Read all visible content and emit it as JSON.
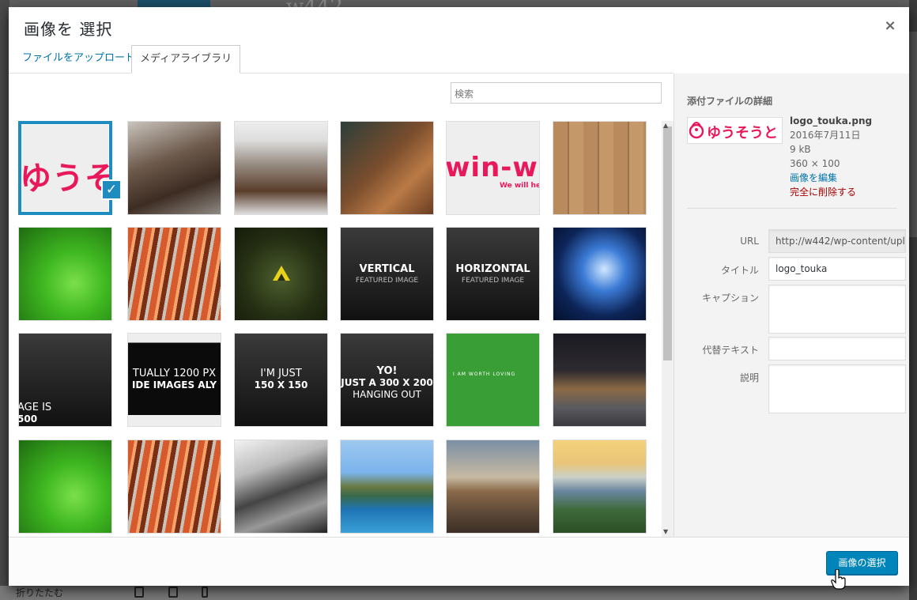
{
  "background": {
    "bottom_label": "折りたたむ",
    "ghost_title": "w442"
  },
  "modal": {
    "title": "画像を 選択",
    "close_label": "×",
    "tabs": [
      {
        "label": "ファイルをアップロード",
        "active": false
      },
      {
        "label": "メディアライブラリ",
        "active": true
      }
    ],
    "search_placeholder": "検索"
  },
  "tiles": [
    {
      "kind": "text-pink",
      "text": "ゆうそう",
      "selected": true
    },
    {
      "kind": "photo",
      "desc": "woman-reading"
    },
    {
      "kind": "photo",
      "desc": "book-coffee"
    },
    {
      "kind": "photo",
      "desc": "notebook-desk"
    },
    {
      "kind": "text-pink",
      "text": "win-wi",
      "sub": "We will hel"
    },
    {
      "kind": "photo",
      "desc": "wood-laptop"
    },
    {
      "kind": "photo",
      "desc": "green-leaf"
    },
    {
      "kind": "photo",
      "desc": "rust-metal"
    },
    {
      "kind": "icon",
      "desc": "triforce"
    },
    {
      "kind": "dark-text",
      "text": "VERTICAL",
      "sub": "FEATURED IMAGE"
    },
    {
      "kind": "dark-text",
      "text": "HORIZONTAL",
      "sub": "FEATURED IMAGE"
    },
    {
      "kind": "photo",
      "desc": "unicorn"
    },
    {
      "kind": "dark-text-left",
      "text": "AGE IS",
      "sub": "500"
    },
    {
      "kind": "dark-text",
      "text": "TUALLY 1200 PX",
      "sub": "IDE IMAGES ALY"
    },
    {
      "kind": "dark-text",
      "text": "I'M JUST",
      "sub": "150 X 150"
    },
    {
      "kind": "dark-text",
      "text": "YO!",
      "sub": "JUST A 300 X 200",
      "sub2": "HANGING OUT"
    },
    {
      "kind": "green",
      "text": "I AM WORTH LOVING"
    },
    {
      "kind": "photo",
      "desc": "city-street"
    },
    {
      "kind": "photo",
      "desc": "green-leaf"
    },
    {
      "kind": "photo",
      "desc": "rust-metal"
    },
    {
      "kind": "photo",
      "desc": "bw-bark"
    },
    {
      "kind": "photo",
      "desc": "sea-cliff"
    },
    {
      "kind": "photo",
      "desc": "rock-beach"
    },
    {
      "kind": "photo",
      "desc": "coast-sunset"
    }
  ],
  "sidebar": {
    "heading": "添付ファイルの詳細",
    "thumb_text": "ゆうそうと",
    "filename": "logo_touka.png",
    "date": "2016年7月11日",
    "size": "9 kB",
    "dimensions": "360 × 100",
    "edit_link": "画像を編集",
    "delete_link": "完全に削除する",
    "fields": {
      "url_label": "URL",
      "url_value": "http://w442/wp-content/upl",
      "title_label": "タイトル",
      "title_value": "logo_touka",
      "caption_label": "キャプション",
      "alt_label": "代替テキスト",
      "desc_label": "説明"
    }
  },
  "footer": {
    "select_button": "画像の選択"
  }
}
